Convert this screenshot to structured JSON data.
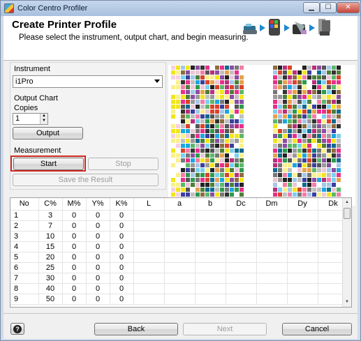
{
  "window": {
    "title": "Color Centro Profiler",
    "minimize": "▁",
    "maximize": "☐",
    "close": "✕"
  },
  "header": {
    "title": "Create Printer Profile",
    "subtitle": "Please select the instrument, output chart, and begin measuring.",
    "steps": [
      "instrument-icon",
      "measure-icon",
      "profile-icon",
      "output-icon"
    ]
  },
  "instrument": {
    "label": "Instrument",
    "value": "i1Pro"
  },
  "output_chart": {
    "label": "Output Chart",
    "copies_label": "Copies",
    "copies_value": "1",
    "output_button": "Output"
  },
  "measurement": {
    "label": "Measurement",
    "start_button": "Start",
    "stop_button": "Stop",
    "save_button": "Save the Result"
  },
  "chart_preview": {
    "left_columns": [
      "1",
      "2",
      "3",
      "4",
      "5",
      "6",
      "7",
      "8",
      "9",
      "10",
      "11",
      "12",
      "13",
      "14",
      "15"
    ],
    "right_columns": [
      "16",
      "17",
      "18",
      "19",
      "20",
      "21",
      "22",
      "23",
      "24",
      "25",
      "26",
      "27",
      "28",
      "29"
    ]
  },
  "table": {
    "columns": [
      "No",
      "C%",
      "M%",
      "Y%",
      "K%",
      "L",
      "a",
      "b",
      "Dc",
      "Dm",
      "Dy",
      "Dk"
    ],
    "rows": [
      [
        "1",
        "3",
        "0",
        "0",
        "0",
        "",
        "",
        "",
        "",
        "",
        "",
        ""
      ],
      [
        "2",
        "7",
        "0",
        "0",
        "0",
        "",
        "",
        "",
        "",
        "",
        "",
        ""
      ],
      [
        "3",
        "10",
        "0",
        "0",
        "0",
        "",
        "",
        "",
        "",
        "",
        "",
        ""
      ],
      [
        "4",
        "15",
        "0",
        "0",
        "0",
        "",
        "",
        "",
        "",
        "",
        "",
        ""
      ],
      [
        "5",
        "20",
        "0",
        "0",
        "0",
        "",
        "",
        "",
        "",
        "",
        "",
        ""
      ],
      [
        "6",
        "25",
        "0",
        "0",
        "0",
        "",
        "",
        "",
        "",
        "",
        "",
        ""
      ],
      [
        "7",
        "30",
        "0",
        "0",
        "0",
        "",
        "",
        "",
        "",
        "",
        "",
        ""
      ],
      [
        "8",
        "40",
        "0",
        "0",
        "0",
        "",
        "",
        "",
        "",
        "",
        "",
        ""
      ],
      [
        "9",
        "50",
        "0",
        "0",
        "0",
        "",
        "",
        "",
        "",
        "",
        "",
        ""
      ]
    ]
  },
  "footer": {
    "help": "?",
    "back": "Back",
    "next": "Next",
    "cancel": "Cancel"
  }
}
